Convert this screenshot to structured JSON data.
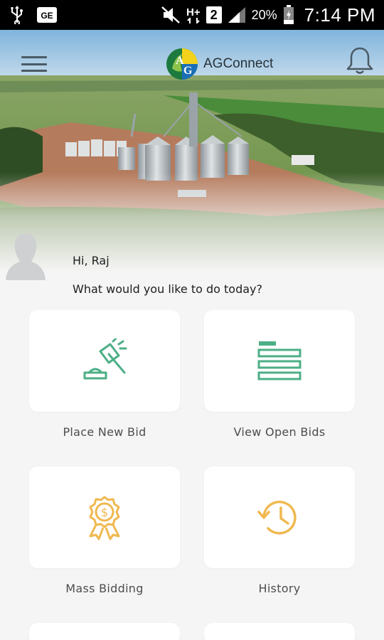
{
  "status_bar": {
    "icons": [
      "usb-icon",
      "ge-icon",
      "mute-icon",
      "signal-hplus-icon",
      "sim-2-icon",
      "cell-signal-icon",
      "battery-icon"
    ],
    "network_label": "H+",
    "sim_label": "2",
    "ge_label": "GE",
    "battery_percent": "20%",
    "time": "7:14 PM"
  },
  "header": {
    "menu_icon": "hamburger-menu-icon",
    "logo_letters": "AG",
    "app_name": "AGConnect",
    "bell_icon": "notification-bell-icon"
  },
  "greeting": {
    "hello": "Hi, Raj",
    "question": "What would you like to do today?"
  },
  "actions": [
    {
      "label": "Place New Bid",
      "icon": "gavel-icon",
      "color": "#4caf86"
    },
    {
      "label": "View Open Bids",
      "icon": "list-icon",
      "color": "#4caf86"
    },
    {
      "label": "Mass Bidding",
      "icon": "award-dollar-icon",
      "color": "#f0b84f"
    },
    {
      "label": "History",
      "icon": "history-clock-icon",
      "color": "#f0b84f"
    }
  ],
  "colors": {
    "accent_green": "#4caf86",
    "accent_gold": "#f0b84f",
    "background": "#f5f5f5"
  }
}
